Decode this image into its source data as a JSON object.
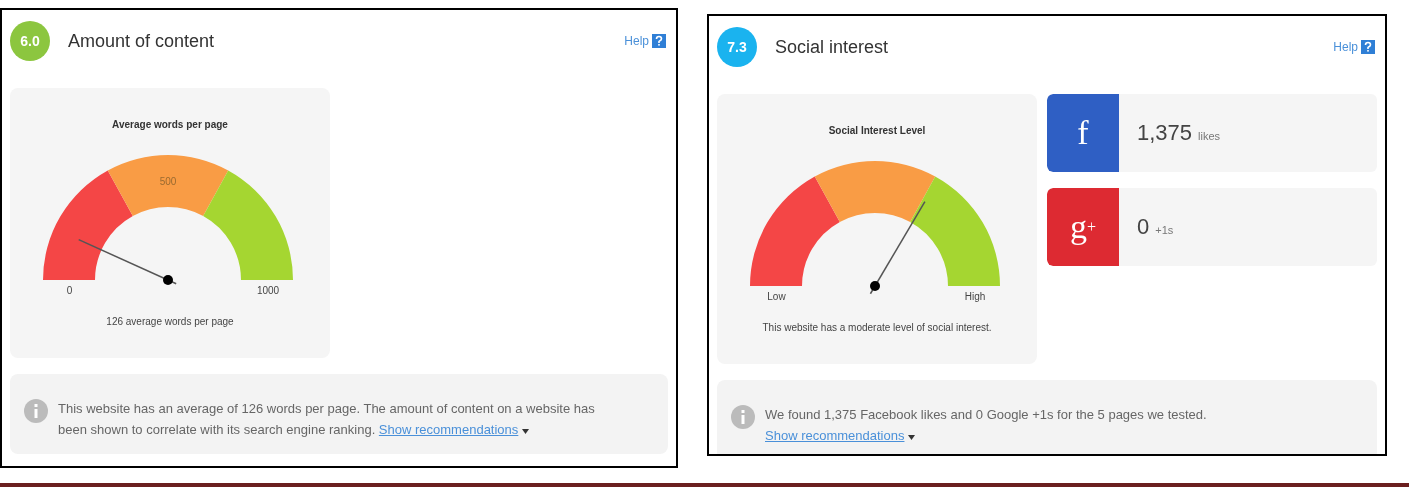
{
  "panels": [
    {
      "score": "6.0",
      "color": "#8cc63f",
      "title": "Amount of content",
      "help": "Help",
      "gauge": {
        "title": "Average words per page",
        "min_label": "0",
        "mid_label": "500",
        "max_label": "1000",
        "caption": "126 average words per page"
      },
      "info": {
        "text": "This website has an average of 126 words per page. The amount of content on a website has been shown to correlate with its search engine ranking.",
        "link": "Show recommendations"
      }
    },
    {
      "score": "7.3",
      "color": "#1ab3ef",
      "title": "Social interest",
      "help": "Help",
      "gauge": {
        "title": "Social Interest Level",
        "min_label": "Low",
        "max_label": "High",
        "caption": "This website has a moderate level of social interest."
      },
      "social": [
        {
          "glyph": "f",
          "color": "#2f5fc4",
          "count": "1,375",
          "unit": "likes"
        },
        {
          "glyph": "g$^{+}$",
          "color": "#dd2a32",
          "count": "0",
          "unit": "+1s"
        }
      ],
      "info": {
        "text": "We found 1,375 Facebook likes and 0 Google +1s for the 5 pages we tested.",
        "link": "Show recommendations"
      }
    }
  ]
}
